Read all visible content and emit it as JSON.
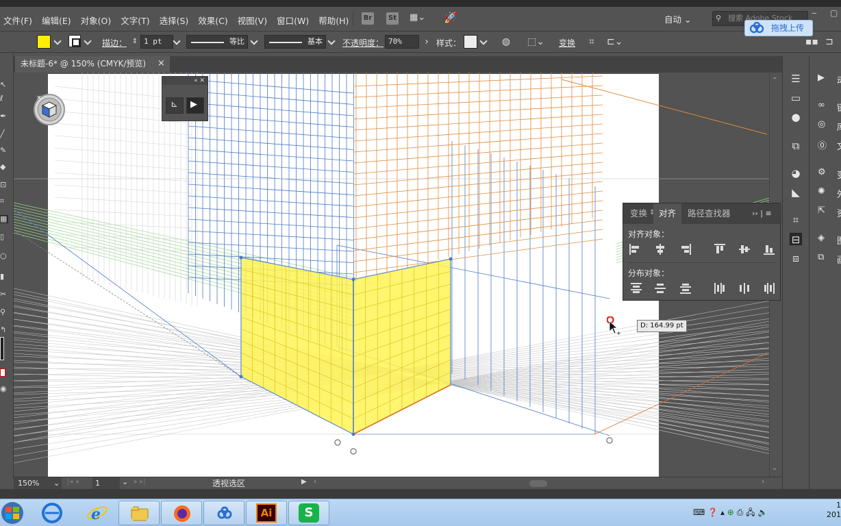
{
  "menubar": {
    "items": [
      "文件(F)",
      "编辑(E)",
      "对象(O)",
      "文字(T)",
      "选择(S)",
      "效果(C)",
      "视图(V)",
      "窗口(W)",
      "帮助(H)"
    ],
    "br_label": "Br",
    "st_label": "St",
    "workspace": "自动",
    "search_placeholder": "搜索 Adobe Stock"
  },
  "baidu": {
    "upload_label": "拖拽上传"
  },
  "controlbar": {
    "fill_color": "#ffef00",
    "stroke_label": "描边：",
    "stroke_weight": "1 pt",
    "profile_label": "等比",
    "brush_label": "基本",
    "opacity_label": "不透明度：",
    "opacity_value": "70%",
    "style_label": "样式：",
    "transform_label": "变换"
  },
  "document": {
    "tab_title": "未标题-6* @ 150% (CMYK/预览)",
    "close": "×"
  },
  "align_panel": {
    "tabs": [
      "变换",
      "对齐",
      "路径查找器"
    ],
    "active_tab": "对齐",
    "align_objects_label": "对齐对象：",
    "distribute_objects_label": "分布对象："
  },
  "tooltip": {
    "text": "D: 164.99 pt"
  },
  "statusbar": {
    "zoom": "150%",
    "page": "1",
    "status_text": "透视选区"
  },
  "dock2": {
    "items": [
      "动",
      "链",
      "库",
      "文",
      "变",
      "外",
      "资",
      "图",
      "画"
    ]
  },
  "clock": {
    "top": "1",
    "bottom": "201"
  },
  "taskbar": {
    "ai_label": "Ai",
    "s_label": "S"
  }
}
